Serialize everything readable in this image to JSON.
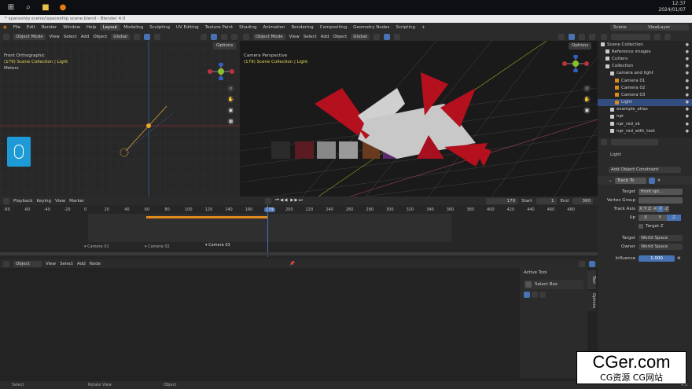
{
  "taskbar": {
    "clock_time": "12:37",
    "clock_date": "2024/01/07"
  },
  "window": {
    "title": "* spaceship scene/\\spaceship scene.blend - Blender 4.0"
  },
  "menu": {
    "items": [
      "File",
      "Edit",
      "Render",
      "Window",
      "Help"
    ],
    "tabs": [
      "Layout",
      "Modeling",
      "Sculpting",
      "UV Editing",
      "Texture Paint",
      "Shading",
      "Animation",
      "Rendering",
      "Compositing",
      "Geometry Nodes",
      "Scripting"
    ],
    "active_tab": "Layout",
    "add_tab": "+",
    "scene": "Scene",
    "view_layer": "ViewLayer"
  },
  "left_viewport": {
    "mode": "Object Mode",
    "menus": [
      "View",
      "Select",
      "Add",
      "Object"
    ],
    "orientation": "Global",
    "view_name": "Front Orthographic",
    "context": "(179) Scene Collection | Light",
    "units": "Meters",
    "options": "Options"
  },
  "right_viewport": {
    "mode": "Object Mode",
    "menus": [
      "View",
      "Select",
      "Add",
      "Object"
    ],
    "orientation": "Global",
    "view_name": "Camera Perspective",
    "context": "(179) Scene Collection | Light",
    "options": "Options"
  },
  "timeline": {
    "menus": [
      "Playback",
      "Keying",
      "View",
      "Marker"
    ],
    "current_frame": "179",
    "start_label": "Start",
    "start": "1",
    "end_label": "End",
    "end": "360",
    "ticks": [
      "-80",
      "-60",
      "-40",
      "-20",
      "0",
      "20",
      "40",
      "60",
      "80",
      "100",
      "120",
      "140",
      "160",
      "179",
      "200",
      "220",
      "240",
      "260",
      "280",
      "300",
      "320",
      "340",
      "360",
      "380",
      "400",
      "420",
      "440",
      "460",
      "480"
    ],
    "markers": [
      "Camera 01",
      "Camera 02",
      "Camera 03"
    ]
  },
  "node_editor": {
    "mode": "Object",
    "menus": [
      "View",
      "Select",
      "Add",
      "Node"
    ],
    "side_tabs": [
      "Tool",
      "Options"
    ],
    "active_tool_title": "Active Tool",
    "active_tool_name": "Select Box"
  },
  "outliner": {
    "rows": [
      {
        "label": "Scene Collection",
        "indent": 0
      },
      {
        "label": "Reference images",
        "indent": 1
      },
      {
        "label": "Cutters",
        "indent": 1
      },
      {
        "label": "Collection",
        "indent": 1
      },
      {
        "label": "camera and light",
        "indent": 2
      },
      {
        "label": "Camera 01",
        "indent": 3
      },
      {
        "label": "Camera 02",
        "indent": 3
      },
      {
        "label": "Camera 03",
        "indent": 3
      },
      {
        "label": "Light",
        "indent": 3,
        "selected": true
      },
      {
        "label": "example_atlas",
        "indent": 2
      },
      {
        "label": "npr",
        "indent": 2
      },
      {
        "label": "npr_red_sk",
        "indent": 2
      },
      {
        "label": "npr_red_with_text",
        "indent": 2
      }
    ]
  },
  "properties": {
    "object_name": "Light",
    "add_constraint": "Add Object Constraint",
    "constraint_name": "Track To",
    "target_label": "Target",
    "target_value": "front spi...",
    "vertex_group_label": "Vertex Group",
    "track_axis_label": "Track Axis",
    "track_axes": [
      "X",
      "Y",
      "Z",
      "-X",
      "-Y",
      "-Z"
    ],
    "up_label": "Up",
    "up_axes": [
      "X",
      "Y",
      "Z"
    ],
    "target_z_label": "Target Z",
    "space_target_label": "Target",
    "space_target_value": "World Space",
    "owner_label": "Owner",
    "owner_value": "World Space",
    "influence_label": "Influence",
    "influence_value": "1.000"
  },
  "status": {
    "items": [
      "Select",
      "Rotate View",
      "Object"
    ],
    "version": "4.0"
  },
  "watermark": {
    "main": "CGer.com",
    "sub": "CG资源 CG网站"
  },
  "colors": {
    "accent": "#4772b3",
    "selected_row": "#334d80",
    "keyframe": "#e08a1e",
    "text_yellow": "#e6d65a",
    "ship_red": "#b5101e"
  }
}
